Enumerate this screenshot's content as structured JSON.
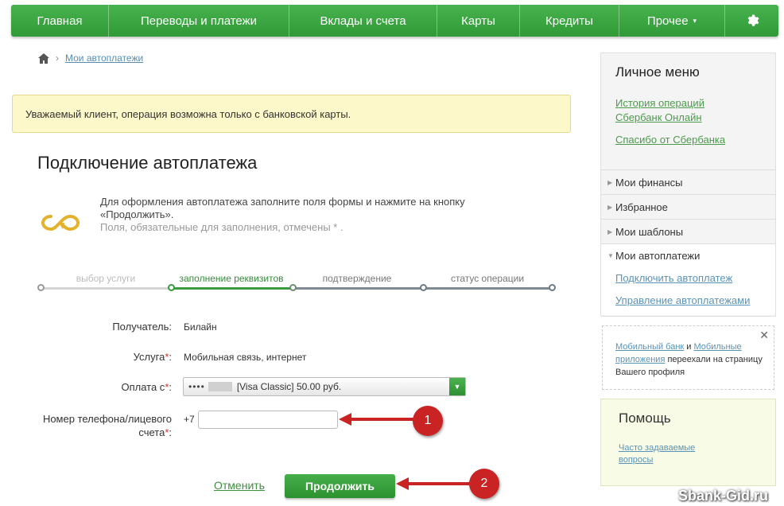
{
  "nav": {
    "items": [
      {
        "label": "Главная"
      },
      {
        "label": "Переводы и платежи"
      },
      {
        "label": "Вклады и счета"
      },
      {
        "label": "Карты"
      },
      {
        "label": "Кредиты"
      },
      {
        "label": "Прочее"
      }
    ],
    "more_caret": "▾",
    "settings_icon": "gear-icon"
  },
  "breadcrumb": {
    "current": "Мои автоплатежи"
  },
  "alert": {
    "text": "Уважаемый клиент, операция возможна только с банковской карты."
  },
  "page": {
    "title": "Подключение автоплатежа",
    "intro_line1": "Для оформления автоплатежа заполните поля формы и нажмите на кнопку «Продолжить».",
    "intro_line2": "Поля, обязательные для заполнения, отмечены * ."
  },
  "steps": [
    {
      "label": "выбор услуги",
      "state": "done"
    },
    {
      "label": "заполнение реквизитов",
      "state": "active"
    },
    {
      "label": "подтверждение",
      "state": "pending"
    },
    {
      "label": "статус операции",
      "state": "pending"
    }
  ],
  "form": {
    "recipient_label": "Получатель:",
    "recipient_value": "Билайн",
    "service_label": "Услуга",
    "service_value": "Мобильная связь, интернет",
    "payfrom_label": "Оплата с",
    "payfrom_masked": "••••",
    "payfrom_value": "[Visa Classic] 50.00 руб.",
    "phone_label_line1": "Номер телефона/лицевого",
    "phone_label_line2": "счета",
    "phone_prefix": "+7",
    "phone_value": "",
    "req_mark": "*",
    "colon": ":"
  },
  "actions": {
    "cancel": "Отменить",
    "continue": "Продолжить"
  },
  "annotations": {
    "badge1": "1",
    "badge2": "2"
  },
  "sidebar": {
    "title": "Личное меню",
    "links": [
      "История операций Сбербанк Онлайн",
      "Спасибо от Сбербанка"
    ],
    "items": [
      "Мои финансы",
      "Избранное",
      "Мои шаблоны",
      "Мои автоплатежи"
    ],
    "sublinks": [
      "Подключить автоплатеж",
      "Управление автоплатежами"
    ]
  },
  "notice": {
    "link1": "Мобильный банк",
    "and": " и ",
    "link2": "Мобильные приложения",
    "rest": " переехали на страницу Вашего профиля"
  },
  "help": {
    "title": "Помощь",
    "link": "Часто задаваемые вопросы"
  },
  "watermark": "Sbank-Gid.ru",
  "colors": {
    "brand_green": "#2f9a36",
    "alert_bg": "#fdf8c9",
    "badge_red": "#c92323"
  }
}
